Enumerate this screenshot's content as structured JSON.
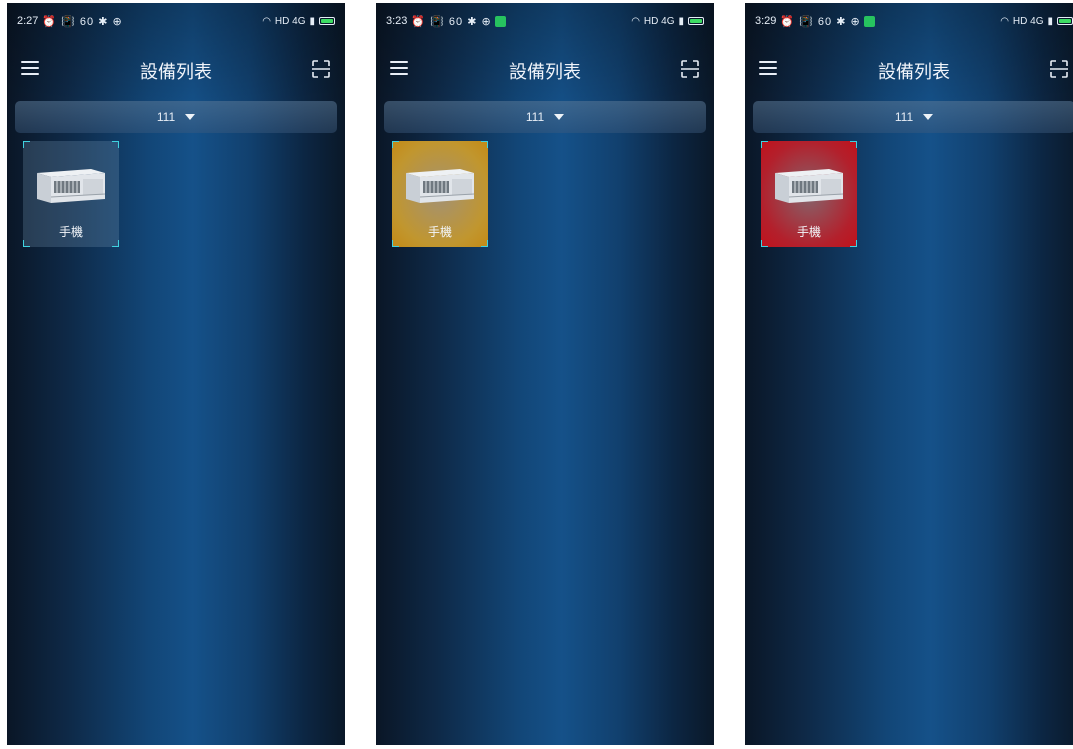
{
  "screens": [
    {
      "status_time": "2:27",
      "status_glyphs": "⏰ 📳 60 ✱ ⊕",
      "status_right": "HD 4G",
      "wechat_notification": false,
      "title": "設備列表",
      "filter_value": "111",
      "device": {
        "name": "手機",
        "state": "normal"
      }
    },
    {
      "status_time": "3:23",
      "status_glyphs": "⏰ 📳 60 ✱ ⊕",
      "status_right": "HD 4G",
      "wechat_notification": true,
      "title": "設備列表",
      "filter_value": "111",
      "device": {
        "name": "手機",
        "state": "warning"
      }
    },
    {
      "status_time": "3:29",
      "status_glyphs": "⏰ 📳 60 ✱ ⊕",
      "status_right": "HD 4G",
      "wechat_notification": true,
      "title": "設備列表",
      "filter_value": "111",
      "device": {
        "name": "手機",
        "state": "alarm"
      }
    }
  ],
  "colors": {
    "warning": "#c1962e",
    "alarm": "#b3202c",
    "corner_accent": "#3fd2e0"
  }
}
